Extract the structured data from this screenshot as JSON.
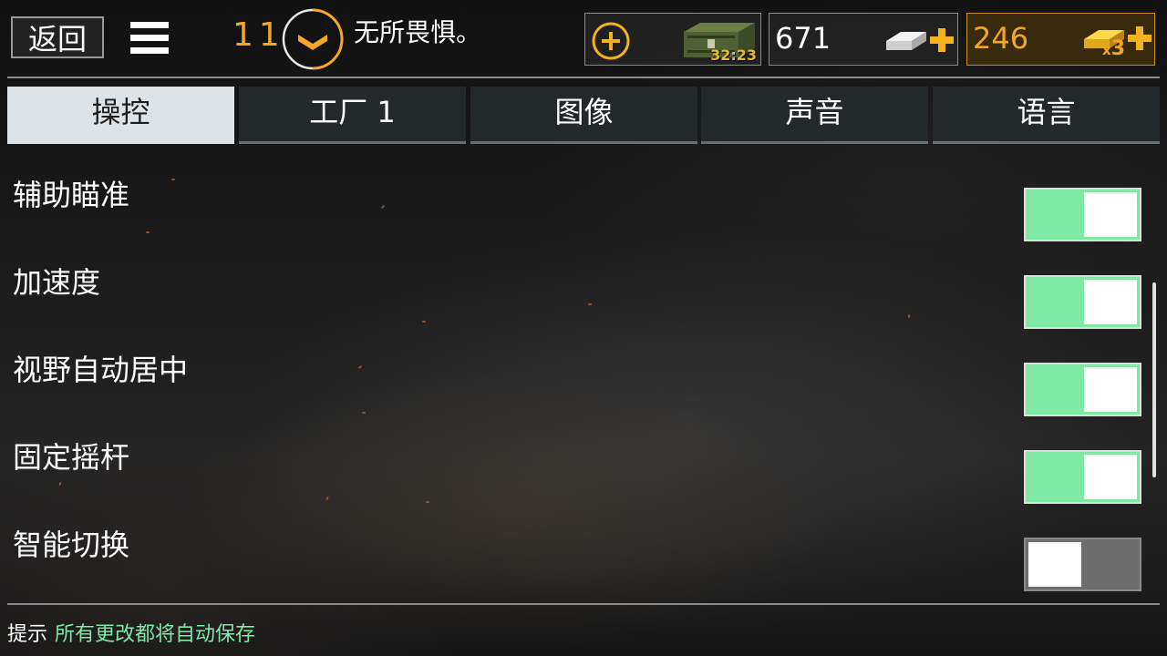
{
  "header": {
    "back_label": "返回",
    "rank_level": "11",
    "player_name": "无所畏惧。",
    "crate_timer": "32:23",
    "silver_amount": "671",
    "gold_amount": "246",
    "gold_multiplier_x": "x",
    "gold_multiplier_n": "3"
  },
  "tabs": [
    {
      "label": "操控",
      "active": true
    },
    {
      "label": "工厂 1",
      "active": false
    },
    {
      "label": "图像",
      "active": false
    },
    {
      "label": "声音",
      "active": false
    },
    {
      "label": "语言",
      "active": false
    }
  ],
  "settings": [
    {
      "label": "辅助瞄准",
      "enabled": true
    },
    {
      "label": "加速度",
      "enabled": true
    },
    {
      "label": "视野自动居中",
      "enabled": true
    },
    {
      "label": "固定摇杆",
      "enabled": true
    },
    {
      "label": "智能切换",
      "enabled": false
    }
  ],
  "footer": {
    "hint_label": "提示",
    "hint_text": "所有更改都将自动保存"
  },
  "colors": {
    "accent_orange": "#f5a623",
    "toggle_on": "#7fe8a6",
    "toggle_off": "#6e6e6e",
    "hint_green": "#7fe8a6"
  },
  "icons": {
    "menu": "hamburger-menu-icon",
    "rank": "rank-chevron-icon",
    "crate_add": "plus-circle-icon",
    "crate": "ammo-crate-icon",
    "silver": "silver-bar-icon",
    "gold": "gold-bar-icon",
    "add": "plus-icon"
  }
}
